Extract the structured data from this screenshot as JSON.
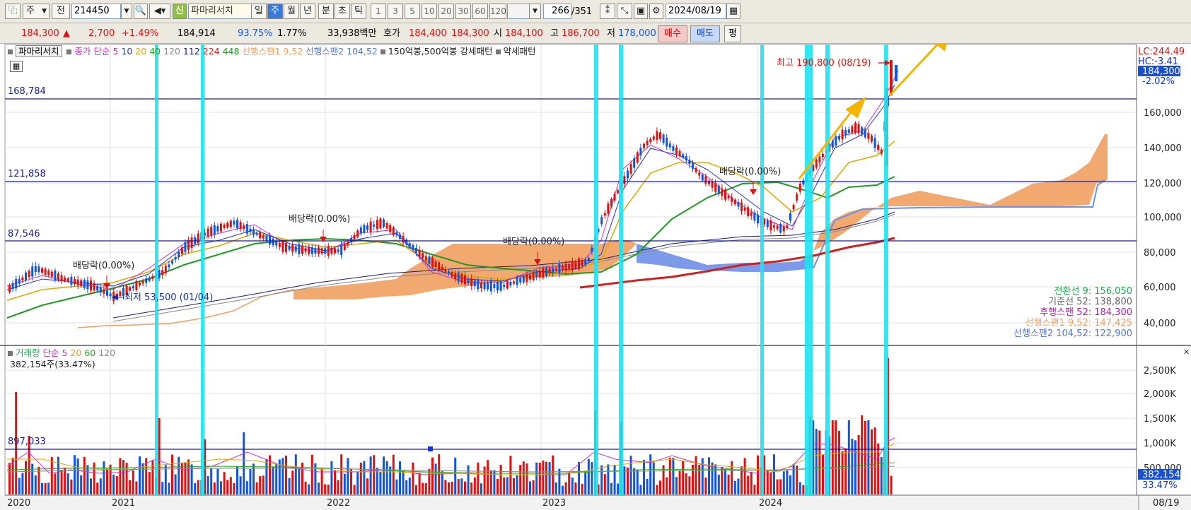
{
  "toolbar": {
    "period_type": "주",
    "prev_label": "전",
    "code": "214450",
    "stock_name": "파마리서치",
    "new_badge": "신",
    "periods": [
      "일",
      "주",
      "월",
      "년",
      "분",
      "초",
      "틱"
    ],
    "active_period": "주",
    "intervals": [
      "1",
      "3",
      "5",
      "10",
      "20",
      "30",
      "60",
      "120"
    ],
    "count_value": "266",
    "count_total": "/351",
    "date": "2024/08/19"
  },
  "quote": {
    "price": "184,300",
    "change_arrow": "▲",
    "change": "2,700",
    "change_pct": "+1.49%",
    "avg_price": "184,914",
    "ratio1": "93.75%",
    "ratio2": "1.77%",
    "trade_amount": "33,938백만",
    "hoga_label": "호가",
    "ask": "184,400",
    "bid": "184,300",
    "open_label": "시",
    "open": "184,100",
    "high_label": "고",
    "high": "186,700",
    "low_label": "저",
    "low": "178,000",
    "buy_label": "매수",
    "sell_label": "매도",
    "eval_label": "평"
  },
  "price_legend": {
    "stock_name": "파마리서치",
    "close_label": "종가",
    "ma_label": "단순",
    "ma_periods": [
      {
        "p": "5",
        "color": "#cc33cc"
      },
      {
        "p": "10",
        "color": "#2233cc"
      },
      {
        "p": "20",
        "color": "#ddaa00"
      },
      {
        "p": "40",
        "color": "#22aa22"
      },
      {
        "p": "120",
        "color": "#888888"
      },
      {
        "p": "112",
        "color": "#1a1a80"
      },
      {
        "p": "224",
        "color": "#dd2222"
      },
      {
        "p": "448",
        "color": "#229922"
      }
    ],
    "span1": "선행스팬1 9,52",
    "span2": "선행스팬2 104,52",
    "pattern": "150억봉,500억봉 강세패턴",
    "weak_pattern": "약세패턴"
  },
  "price_axis": {
    "ticks": [
      "160,000",
      "140,000",
      "120,000",
      "100,000",
      "80,000",
      "60,000",
      "40,000"
    ],
    "lc": "LC:244.49",
    "hc": "HC:-3.41",
    "current_price": "184,300",
    "current_pct": "-2.02%"
  },
  "hlines": [
    "168,784",
    "121,858",
    "87,546"
  ],
  "annotations": {
    "high_label": "최고 190,800 (08/19)",
    "low_label": "최저 53,500 (01/04)",
    "exdiv": "배당락(0.00%)"
  },
  "ichimoku": [
    {
      "label": "전환선 9: 156,050",
      "color": "#22aa55"
    },
    {
      "label": "기준선 52: 138,800",
      "color": "#666666"
    },
    {
      "label": "후행스팬 52: 184,300",
      "color": "#aa22aa"
    },
    {
      "label": "선행스팬1 9,52: 147,425",
      "color": "#f0a060"
    },
    {
      "label": "선행스팬2 104,52: 122,900",
      "color": "#5577cc"
    }
  ],
  "volume_legend": {
    "label": "거래량",
    "ma_label": "단순",
    "periods": [
      {
        "p": "5",
        "color": "#cc33cc"
      },
      {
        "p": "20",
        "color": "#ddaa00"
      },
      {
        "p": "60",
        "color": "#22aa22"
      },
      {
        "p": "120",
        "color": "#888888"
      }
    ],
    "current": "382,154주(33.47%)"
  },
  "volume_axis": {
    "ticks": [
      "2,500K",
      "2,000K",
      "1,500K",
      "1,000K",
      "500,000"
    ],
    "hline": "897,033",
    "current": "382,154",
    "current_pct": "33.47%"
  },
  "x_axis": {
    "labels": [
      "2020",
      "2021",
      "2022",
      "2023",
      "2024"
    ],
    "end_label": "08/19"
  },
  "colors": {
    "up": "#dd1111",
    "down": "#1155dd",
    "highlight": "#1de4f0",
    "cloud_bull": "#f0a060",
    "cloud_bear": "#6f8fe8",
    "arrow": "#f5b400"
  }
}
